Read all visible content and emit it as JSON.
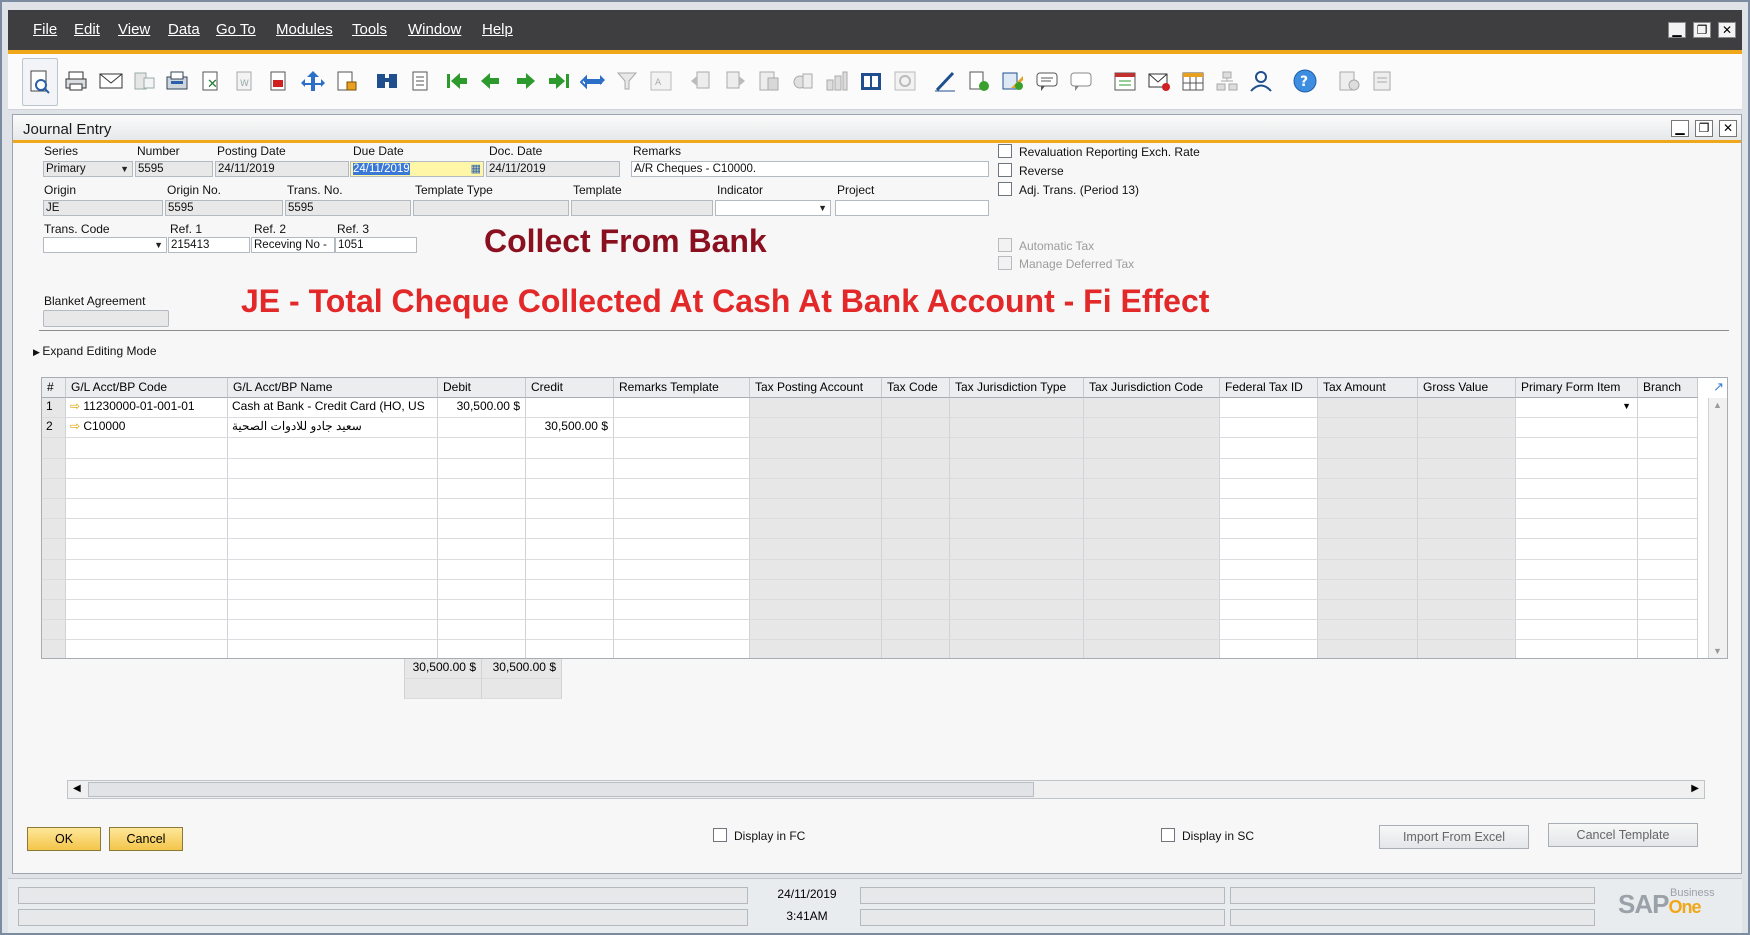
{
  "menu": [
    "File",
    "Edit",
    "View",
    "Data",
    "Go To",
    "Modules",
    "Tools",
    "Window",
    "Help"
  ],
  "window_controls": {
    "minimize": "▁",
    "restore": "❐",
    "close": "✕"
  },
  "toolbar_icons": [
    "preview-icon",
    "print-icon",
    "email-icon",
    "sms-icon",
    "fax-icon",
    "excel-icon",
    "word-icon",
    "pdf-icon",
    "launch-icon",
    "lock-icon",
    "find-icon",
    "add-icon",
    "first-record-icon",
    "previous-record-icon",
    "next-record-icon",
    "last-record-icon",
    "refresh-icon",
    "filter-icon",
    "sort-icon",
    "base-document-icon",
    "target-document-icon",
    "gross-profit-icon",
    "payment-means-icon",
    "volume-weight-icon",
    "journal-voucher-icon",
    "settings-icon",
    "edit-form-icon",
    "form-settings-icon",
    "message-icon",
    "alerts-icon",
    "calendar-icon",
    "messages-icon",
    "grid-icon",
    "org-icon",
    "user-icon",
    "help-icon",
    "extra-icon-1",
    "extra-icon-2"
  ],
  "document": {
    "title": "Journal Entry",
    "header": {
      "series_label": "Series",
      "series_value": "Primary",
      "number_label": "Number",
      "number_value": "5595",
      "posting_date_label": "Posting Date",
      "posting_date_value": "24/11/2019",
      "due_date_label": "Due Date",
      "due_date_value": "24/11/2019",
      "doc_date_label": "Doc. Date",
      "doc_date_value": "24/11/2019",
      "remarks_label": "Remarks",
      "remarks_value": "A/R Cheques - C10000.",
      "origin_label": "Origin",
      "origin_value": "JE",
      "origin_no_label": "Origin No.",
      "origin_no_value": "5595",
      "trans_no_label": "Trans. No.",
      "trans_no_value": "5595",
      "template_type_label": "Template Type",
      "template_type_value": "",
      "template_label": "Template",
      "template_value": "",
      "indicator_label": "Indicator",
      "indicator_value": "",
      "project_label": "Project",
      "project_value": "",
      "trans_code_label": "Trans. Code",
      "trans_code_value": "",
      "ref1_label": "Ref. 1",
      "ref1_value": "215413",
      "ref2_label": "Ref. 2",
      "ref2_value": "Receving No -",
      "ref3_label": "Ref. 3",
      "ref3_value": "1051",
      "blanket_label": "Blanket Agreement",
      "blanket_value": ""
    },
    "checkboxes": {
      "revaluation": "Revaluation Reporting Exch. Rate",
      "reverse": "Reverse",
      "adj_trans": "Adj. Trans. (Period 13)",
      "automatic_tax": "Automatic Tax",
      "manage_deferred_tax": "Manage Deferred Tax"
    },
    "overlay_text_1": "Collect From Bank",
    "overlay_text_2": "JE - Total Cheque Collected At Cash At Bank Account - Fi Effect",
    "expand_editing_mode": "Expand Editing Mode",
    "grid": {
      "columns": [
        "#",
        "G/L Acct/BP Code",
        "G/L Acct/BP Name",
        "Debit",
        "Credit",
        "Remarks Template",
        "Tax Posting Account",
        "Tax Code",
        "Tax Jurisdiction Type",
        "Tax Jurisdiction Code",
        "Federal Tax ID",
        "Tax Amount",
        "Gross Value",
        "Primary Form Item",
        "Branch"
      ],
      "rows": [
        {
          "num": "1",
          "code": "11230000-01-001-01",
          "name": "Cash at Bank - Credit Card (HO, US",
          "debit": "30,500.00 $",
          "credit": ""
        },
        {
          "num": "2",
          "code": "C10000",
          "name": "سعيد جادو للادوات الصحية",
          "debit": "",
          "credit": "30,500.00 $"
        }
      ],
      "totals": {
        "debit": "30,500.00 $",
        "credit": "30,500.00 $"
      }
    },
    "buttons": {
      "ok": "OK",
      "cancel": "Cancel",
      "import_excel": "Import From Excel",
      "cancel_template": "Cancel Template"
    },
    "display_fc": "Display in FC",
    "display_sc": "Display in SC"
  },
  "status": {
    "date": "24/11/2019",
    "time": "3:41AM"
  },
  "brand": {
    "name": "SAP",
    "product": "One",
    "sub": "Business"
  },
  "colors": {
    "accent": "#f0a81a",
    "overlay1": "#8a1020",
    "overlay2": "#e22828",
    "menubar": "#3e3e40"
  }
}
